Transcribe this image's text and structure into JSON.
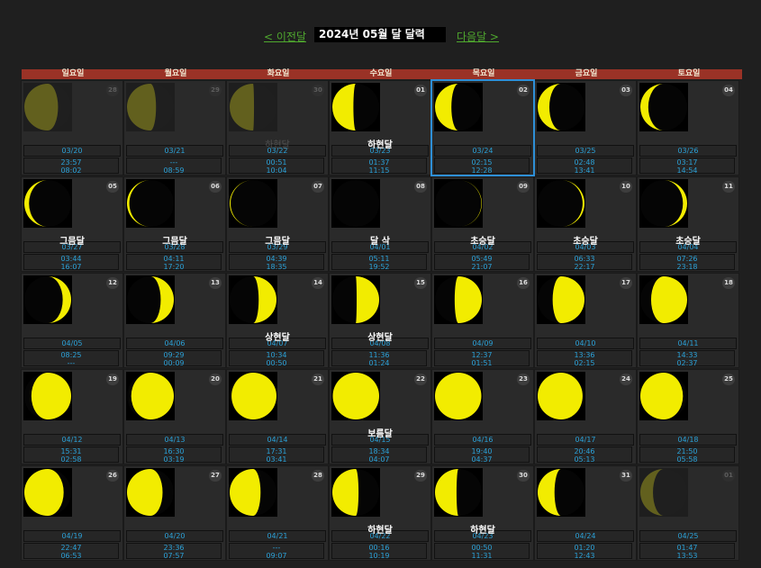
{
  "nav": {
    "prev_label": "< 이전달",
    "title": "2024년 05월 달 달력",
    "next_label": "다음달 >"
  },
  "weekdays": [
    "일요일",
    "월요일",
    "화요일",
    "수요일",
    "목요일",
    "금요일",
    "토요일"
  ],
  "colors": {
    "moon_lit": "#f2ec00",
    "moon_dark": "#050505",
    "header_bar": "#9a3226",
    "time_text": "#2ba0d6",
    "selected_border": "#2e8fd6"
  },
  "weeks": [
    [
      {
        "day": "28",
        "lunar_date": "03/20",
        "moonrise": "23:57",
        "moonset": "08:02",
        "phase_label": "",
        "illumination": 0.72,
        "waxing": false,
        "current_month": false,
        "selected": false
      },
      {
        "day": "29",
        "lunar_date": "03/21",
        "moonrise": "---",
        "moonset": "08:59",
        "phase_label": "",
        "illumination": 0.62,
        "waxing": false,
        "current_month": false,
        "selected": false
      },
      {
        "day": "30",
        "lunar_date": "03/22",
        "moonrise": "00:51",
        "moonset": "10:04",
        "phase_label": "하현달",
        "illumination": 0.52,
        "waxing": false,
        "current_month": false,
        "selected": false
      },
      {
        "day": "01",
        "lunar_date": "03/23",
        "moonrise": "01:37",
        "moonset": "11:15",
        "phase_label": "하현달",
        "illumination": 0.45,
        "waxing": false,
        "current_month": true,
        "selected": false
      },
      {
        "day": "02",
        "lunar_date": "03/24",
        "moonrise": "02:15",
        "moonset": "12:28",
        "phase_label": "",
        "illumination": 0.35,
        "waxing": false,
        "current_month": true,
        "selected": true
      },
      {
        "day": "03",
        "lunar_date": "03/25",
        "moonrise": "02:48",
        "moonset": "13:41",
        "phase_label": "",
        "illumination": 0.25,
        "waxing": false,
        "current_month": true,
        "selected": false
      },
      {
        "day": "04",
        "lunar_date": "03/26",
        "moonrise": "03:17",
        "moonset": "14:54",
        "phase_label": "",
        "illumination": 0.17,
        "waxing": false,
        "current_month": true,
        "selected": false
      }
    ],
    [
      {
        "day": "05",
        "lunar_date": "03/27",
        "moonrise": "03:44",
        "moonset": "16:07",
        "phase_label": "그믐달",
        "illumination": 0.1,
        "waxing": false,
        "current_month": true,
        "selected": false
      },
      {
        "day": "06",
        "lunar_date": "03/28",
        "moonrise": "04:11",
        "moonset": "17:20",
        "phase_label": "그믐달",
        "illumination": 0.05,
        "waxing": false,
        "current_month": true,
        "selected": false
      },
      {
        "day": "07",
        "lunar_date": "03/29",
        "moonrise": "04:39",
        "moonset": "18:35",
        "phase_label": "그믐달",
        "illumination": 0.02,
        "waxing": false,
        "current_month": true,
        "selected": false
      },
      {
        "day": "08",
        "lunar_date": "04/01",
        "moonrise": "05:11",
        "moonset": "19:52",
        "phase_label": "달 삭",
        "illumination": 0.0,
        "waxing": true,
        "current_month": true,
        "selected": false
      },
      {
        "day": "09",
        "lunar_date": "04/02",
        "moonrise": "05:49",
        "moonset": "21:07",
        "phase_label": "초승달",
        "illumination": 0.01,
        "waxing": true,
        "current_month": true,
        "selected": false
      },
      {
        "day": "10",
        "lunar_date": "04/03",
        "moonrise": "06:33",
        "moonset": "22:17",
        "phase_label": "초승달",
        "illumination": 0.04,
        "waxing": true,
        "current_month": true,
        "selected": false
      },
      {
        "day": "11",
        "lunar_date": "04/04",
        "moonrise": "07:26",
        "moonset": "23:18",
        "phase_label": "초승달",
        "illumination": 0.09,
        "waxing": true,
        "current_month": true,
        "selected": false
      }
    ],
    [
      {
        "day": "12",
        "lunar_date": "04/05",
        "moonrise": "08:25",
        "moonset": "---",
        "phase_label": "",
        "illumination": 0.18,
        "waxing": true,
        "current_month": true,
        "selected": false
      },
      {
        "day": "13",
        "lunar_date": "04/06",
        "moonrise": "09:29",
        "moonset": "00:09",
        "phase_label": "",
        "illumination": 0.28,
        "waxing": true,
        "current_month": true,
        "selected": false
      },
      {
        "day": "14",
        "lunar_date": "04/07",
        "moonrise": "10:34",
        "moonset": "00:50",
        "phase_label": "상현달",
        "illumination": 0.38,
        "waxing": true,
        "current_month": true,
        "selected": false
      },
      {
        "day": "15",
        "lunar_date": "04/08",
        "moonrise": "11:36",
        "moonset": "01:24",
        "phase_label": "상현달",
        "illumination": 0.48,
        "waxing": true,
        "current_month": true,
        "selected": false
      },
      {
        "day": "16",
        "lunar_date": "04/09",
        "moonrise": "12:37",
        "moonset": "01:51",
        "phase_label": "",
        "illumination": 0.58,
        "waxing": true,
        "current_month": true,
        "selected": false
      },
      {
        "day": "17",
        "lunar_date": "04/10",
        "moonrise": "13:36",
        "moonset": "02:15",
        "phase_label": "",
        "illumination": 0.68,
        "waxing": true,
        "current_month": true,
        "selected": false
      },
      {
        "day": "18",
        "lunar_date": "04/11",
        "moonrise": "14:33",
        "moonset": "02:37",
        "phase_label": "",
        "illumination": 0.77,
        "waxing": true,
        "current_month": true,
        "selected": false
      }
    ],
    [
      {
        "day": "19",
        "lunar_date": "04/12",
        "moonrise": "15:31",
        "moonset": "02:58",
        "phase_label": "",
        "illumination": 0.85,
        "waxing": true,
        "current_month": true,
        "selected": false
      },
      {
        "day": "20",
        "lunar_date": "04/13",
        "moonrise": "16:30",
        "moonset": "03:19",
        "phase_label": "",
        "illumination": 0.91,
        "waxing": true,
        "current_month": true,
        "selected": false
      },
      {
        "day": "21",
        "lunar_date": "04/14",
        "moonrise": "17:31",
        "moonset": "03:41",
        "phase_label": "",
        "illumination": 0.96,
        "waxing": true,
        "current_month": true,
        "selected": false
      },
      {
        "day": "22",
        "lunar_date": "04/15",
        "moonrise": "18:34",
        "moonset": "04:07",
        "phase_label": "보름달",
        "illumination": 0.99,
        "waxing": true,
        "current_month": true,
        "selected": false
      },
      {
        "day": "23",
        "lunar_date": "04/16",
        "moonrise": "19:40",
        "moonset": "04:37",
        "phase_label": "",
        "illumination": 0.99,
        "waxing": false,
        "current_month": true,
        "selected": false
      },
      {
        "day": "24",
        "lunar_date": "04/17",
        "moonrise": "20:46",
        "moonset": "05:13",
        "phase_label": "",
        "illumination": 0.96,
        "waxing": false,
        "current_month": true,
        "selected": false
      },
      {
        "day": "25",
        "lunar_date": "04/18",
        "moonrise": "21:50",
        "moonset": "05:58",
        "phase_label": "",
        "illumination": 0.91,
        "waxing": false,
        "current_month": true,
        "selected": false
      }
    ],
    [
      {
        "day": "26",
        "lunar_date": "04/19",
        "moonrise": "22:47",
        "moonset": "06:53",
        "phase_label": "",
        "illumination": 0.84,
        "waxing": false,
        "current_month": true,
        "selected": false
      },
      {
        "day": "27",
        "lunar_date": "04/20",
        "moonrise": "23:36",
        "moonset": "07:57",
        "phase_label": "",
        "illumination": 0.76,
        "waxing": false,
        "current_month": true,
        "selected": false
      },
      {
        "day": "28",
        "lunar_date": "04/21",
        "moonrise": "---",
        "moonset": "09:07",
        "phase_label": "",
        "illumination": 0.66,
        "waxing": false,
        "current_month": true,
        "selected": false
      },
      {
        "day": "29",
        "lunar_date": "04/22",
        "moonrise": "00:16",
        "moonset": "10:19",
        "phase_label": "하현달",
        "illumination": 0.56,
        "waxing": false,
        "current_month": true,
        "selected": false
      },
      {
        "day": "30",
        "lunar_date": "04/23",
        "moonrise": "00:50",
        "moonset": "11:31",
        "phase_label": "하현달",
        "illumination": 0.46,
        "waxing": false,
        "current_month": true,
        "selected": false
      },
      {
        "day": "31",
        "lunar_date": "04/24",
        "moonrise": "01:20",
        "moonset": "12:43",
        "phase_label": "",
        "illumination": 0.36,
        "waxing": false,
        "current_month": true,
        "selected": false
      },
      {
        "day": "01",
        "lunar_date": "04/25",
        "moonrise": "01:47",
        "moonset": "13:53",
        "phase_label": "",
        "illumination": 0.27,
        "waxing": false,
        "current_month": false,
        "selected": false
      }
    ]
  ]
}
